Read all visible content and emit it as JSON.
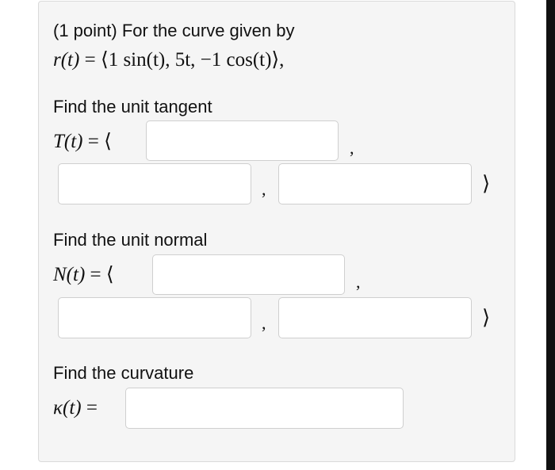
{
  "problem": {
    "intro": "(1 point) For the curve given by",
    "curve_lhs": "r(t)",
    "curve_eq": "=",
    "curve_rhs": "⟨1 sin(t), 5t, −1 cos(t)⟩,"
  },
  "tangent": {
    "prompt": "Find the unit tangent",
    "symbol": "T(t)",
    "eq_open": "= ⟨",
    "separator": ",",
    "close": "⟩",
    "answers": [
      "",
      "",
      ""
    ]
  },
  "normal": {
    "prompt": "Find the unit normal",
    "symbol": "N(t)",
    "eq_open": "= ⟨",
    "separator": ",",
    "close": "⟩",
    "answers": [
      "",
      "",
      ""
    ]
  },
  "curvature": {
    "prompt": "Find the curvature",
    "symbol": "κ(t)",
    "eq": "=",
    "answer": ""
  }
}
